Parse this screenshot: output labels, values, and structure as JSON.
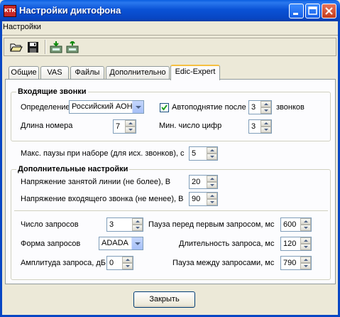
{
  "window": {
    "title": "Настройки диктофона",
    "icon_text": "КТК"
  },
  "menu": {
    "items": [
      "Настройки"
    ]
  },
  "toolbar": {
    "icons": [
      "open-folder-icon",
      "save-disk-icon",
      "import-icon",
      "export-icon"
    ]
  },
  "tabs": [
    "Общие",
    "VAS",
    "Файлы",
    "Дополнительно",
    "Edic-Expert"
  ],
  "active_tab": "Edic-Expert",
  "incoming_calls": {
    "title": "Входящие звонки",
    "definition_label": "Определение",
    "definition_value": "Российский АОН",
    "autopickup_label": "Автоподнятие после",
    "autopickup_checked": true,
    "autopickup_value": "3",
    "calls_label": "звонков",
    "number_length_label": "Длина номера",
    "number_length_value": "7",
    "min_digits_label": "Мин. число цифр",
    "min_digits_value": "3"
  },
  "max_pause": {
    "label": "Макс. паузы при наборе (для исх. звонков), с",
    "value": "5"
  },
  "additional": {
    "title": "Дополнительные настройки",
    "busy_voltage_label": "Напряжение занятой линии (не более), В",
    "busy_voltage_value": "20",
    "ring_voltage_label": "Напряжение входящего звонка (не менее), В",
    "ring_voltage_value": "90"
  },
  "requests": {
    "count_label": "Число запросов",
    "count_value": "3",
    "pause_before_label": "Пауза перед первым запросом, мс",
    "pause_before_value": "600",
    "form_label": "Форма запросов",
    "form_value": "ADADA",
    "duration_label": "Длительность запроса, мс",
    "duration_value": "120",
    "amplitude_label": "Амплитуда запроса, дБ",
    "amplitude_value": "0",
    "pause_between_label": "Пауза между запросами, мс",
    "pause_between_value": "790"
  },
  "footer": {
    "close_label": "Закрыть"
  }
}
